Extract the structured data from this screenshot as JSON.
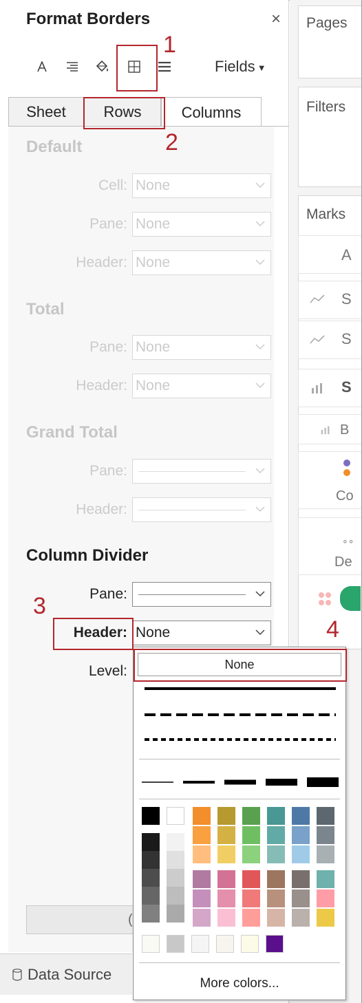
{
  "format_pane": {
    "title": "Format Borders",
    "close_label": "×",
    "fields_label": "Fields",
    "tabs": [
      {
        "label": "Sheet"
      },
      {
        "label": "Rows"
      },
      {
        "label": "Columns"
      }
    ]
  },
  "sections": {
    "default": {
      "title": "Default",
      "rows": [
        {
          "label": "Cell:",
          "value": "None"
        },
        {
          "label": "Pane:",
          "value": "None"
        },
        {
          "label": "Header:",
          "value": "None"
        }
      ]
    },
    "total": {
      "title": "Total",
      "rows": [
        {
          "label": "Pane:",
          "value": "None"
        },
        {
          "label": "Header:",
          "value": "None"
        }
      ]
    },
    "grand_total": {
      "title": "Grand Total",
      "rows": [
        {
          "label": "Pane:"
        },
        {
          "label": "Header:"
        }
      ]
    },
    "column_divider": {
      "title": "Column Divider",
      "rows": [
        {
          "label": "Pane:"
        },
        {
          "label": "Header:",
          "value": "None"
        },
        {
          "label": "Level:"
        }
      ]
    }
  },
  "bottom": {
    "data_source_label": "Data Source",
    "hidden_button_char": "("
  },
  "right_pane": {
    "pages_label": "Pages",
    "filters_label": "Filters",
    "marks_label": "Marks",
    "mark_row_letters": [
      "A",
      "S",
      "S",
      "S",
      "B"
    ],
    "card_letters": [
      "Co",
      "De"
    ]
  },
  "popup": {
    "none_label": "None",
    "more_colors_label": "More colors...",
    "color_columns": [
      [
        "#f28e2b",
        "#f9a040",
        "#ffbe7d"
      ],
      [
        "#b69a2f",
        "#d3b243",
        "#f1ce63"
      ],
      [
        "#59a14f",
        "#6fbf62",
        "#8cd17d"
      ],
      [
        "#499894",
        "#62aaa5",
        "#86bcb6"
      ],
      [
        "#4e79a7",
        "#79a1c9",
        "#a0cbe8"
      ],
      [
        "#5c6770",
        "#7b858e",
        "#a9b0b4"
      ]
    ],
    "color_columns_2": [
      [
        "#b07aa1",
        "#c58fbb",
        "#d4a6c8"
      ],
      [
        "#d37295",
        "#e48fab",
        "#fabfd2"
      ],
      [
        "#e15759",
        "#f07a79",
        "#ff9d9a"
      ],
      [
        "#9d7660",
        "#b8917d",
        "#d7b5a6"
      ],
      [
        "#79706e",
        "#998f8b",
        "#bab0ac"
      ],
      [
        "#6fb1ac",
        "#ff9da7",
        "#edc948"
      ]
    ],
    "grays_dark": [
      "#1a1a1a",
      "#333333",
      "#4d4d4d",
      "#666666",
      "#808080"
    ],
    "grays_light": [
      "#f2f2f2",
      "#e0e0e0",
      "#cccccc",
      "#bdbdbd",
      "#aaaaaa"
    ],
    "bottom_swatches": [
      "#fafaf5",
      "#c8c8c8",
      "#f5f5f5",
      "#f6f6ee",
      "#fbfbe8",
      "#5a0f8c"
    ]
  },
  "annotations": [
    "1",
    "2",
    "3",
    "4"
  ],
  "colors": {
    "annotation": "#b3262c"
  }
}
